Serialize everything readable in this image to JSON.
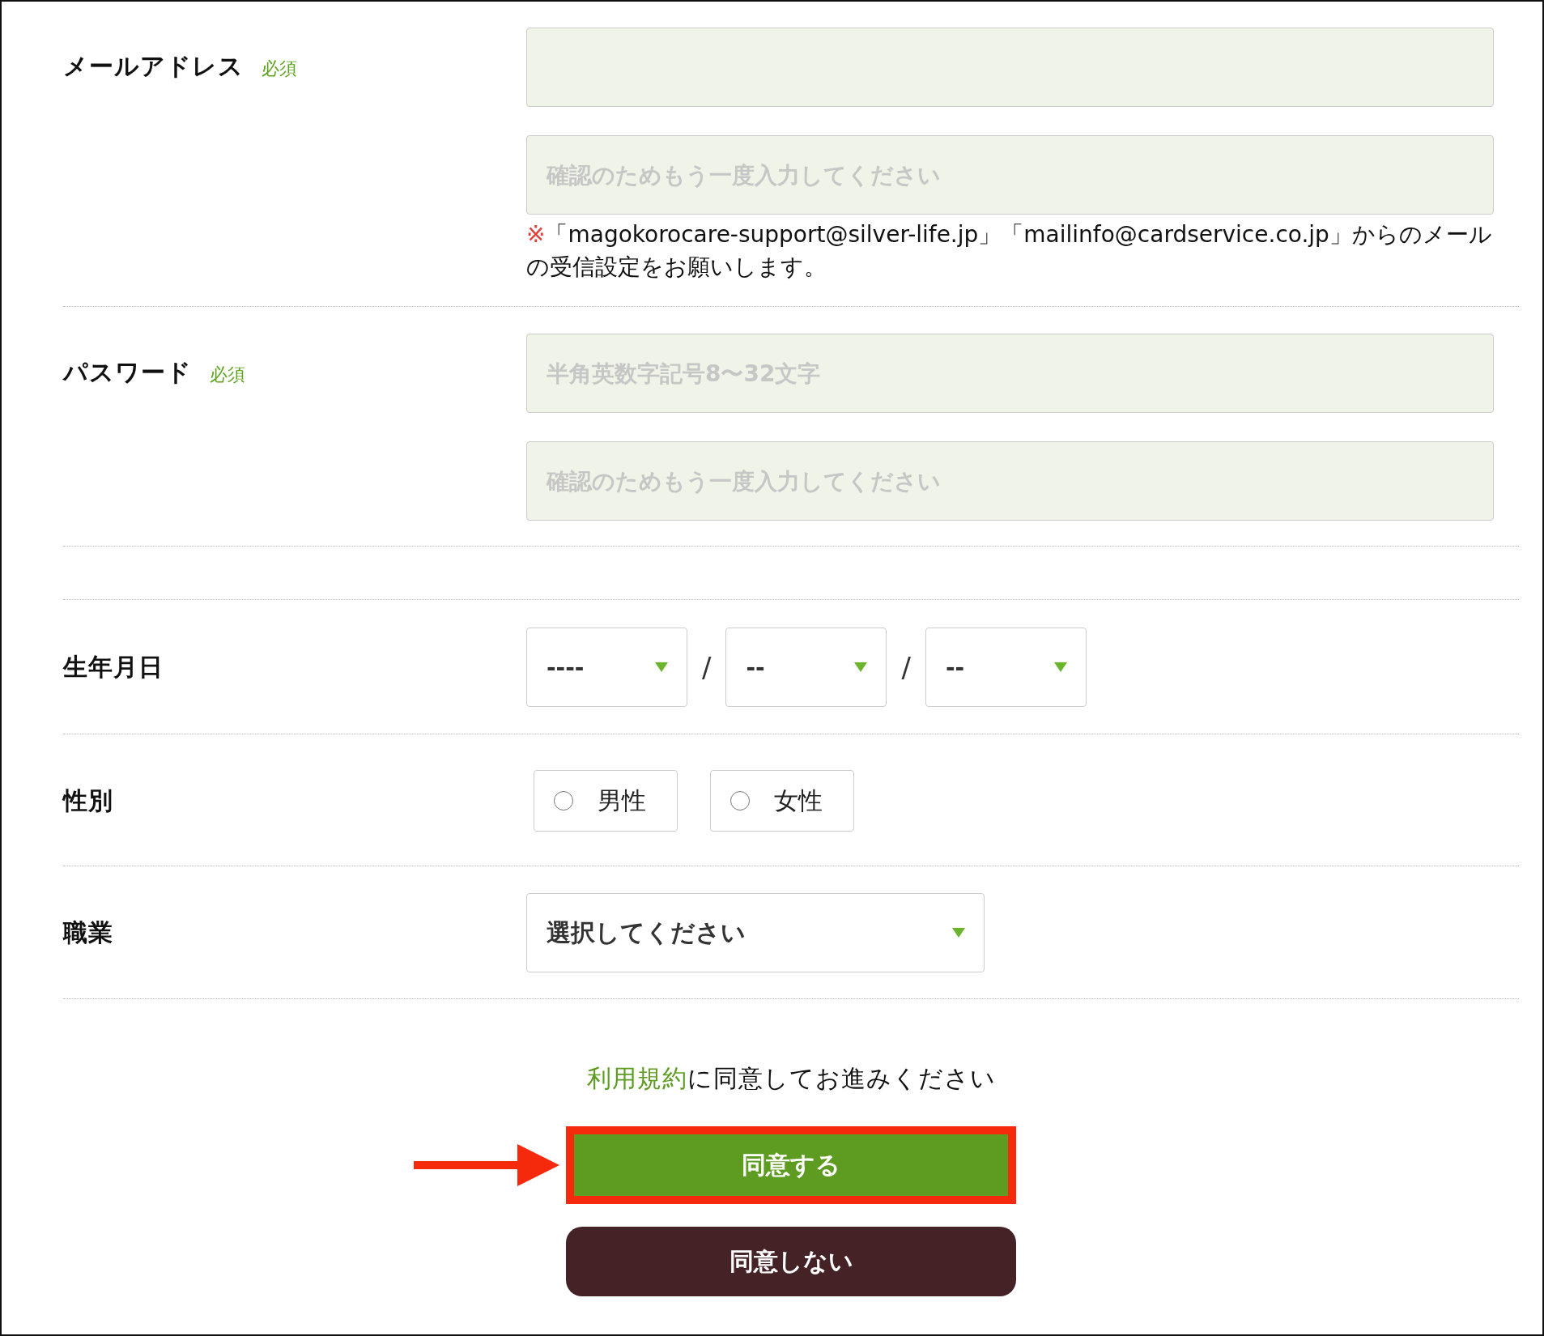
{
  "rows": [
    {
      "kind": "text",
      "label": "メールアドレス",
      "badge": "必須",
      "inputs": [
        {
          "kind": "field"
        },
        {
          "kind": "field",
          "placeholder": "確認のためもう一度入力してください"
        }
      ],
      "note": {
        "mark": "※",
        "text": "「magokorocare-support@silver-life.jp」「mailinfo@cardservice.co.jp」からのメールの受信設定をお願いします。"
      }
    },
    {
      "kind": "text",
      "label": "パスワード",
      "badge": "必須",
      "inputs": [
        {
          "kind": "field",
          "placeholder": "半角英数字記号8〜32文字"
        },
        {
          "kind": "field",
          "placeholder": "確認のためもう一度入力してください"
        }
      ]
    },
    {
      "kind": "spacer"
    },
    {
      "kind": "date",
      "label": "生年月日",
      "selects": [
        "----",
        "--",
        "--"
      ],
      "separators": [
        "/",
        "/"
      ]
    },
    {
      "kind": "radio",
      "label": "性別",
      "options": [
        {
          "label": "男性",
          "selected": false
        },
        {
          "label": "女性",
          "selected": false
        }
      ]
    },
    {
      "kind": "select",
      "label": "職業",
      "value": "選択してください"
    }
  ],
  "agreement": {
    "link": "利用規約",
    "text": "に同意してお進みください"
  },
  "buttons": [
    {
      "label": "同意する",
      "kind": "primary",
      "highlighted": true
    },
    {
      "label": "同意しない",
      "kind": "secondary",
      "highlighted": false
    }
  ]
}
